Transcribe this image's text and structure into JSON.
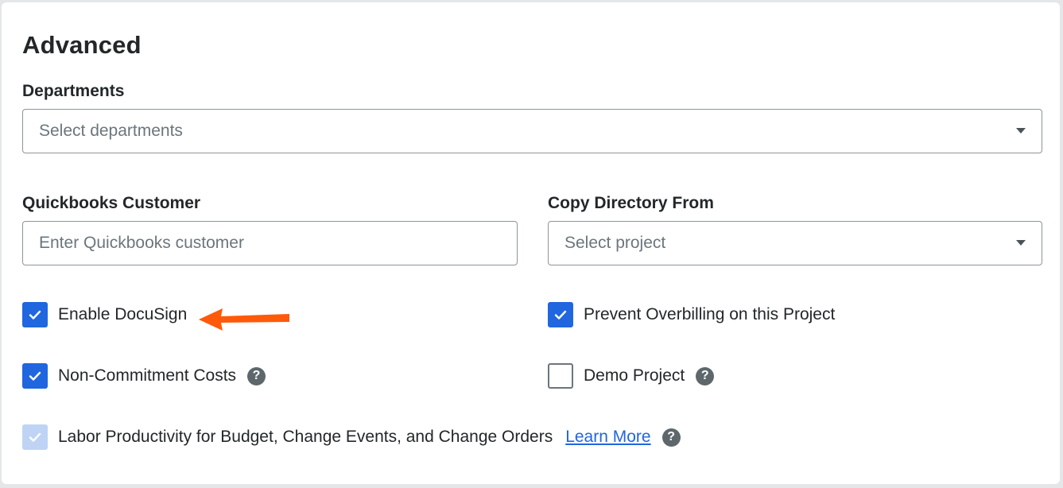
{
  "section": {
    "title": "Advanced"
  },
  "departments": {
    "label": "Departments",
    "placeholder": "Select departments"
  },
  "quickbooks": {
    "label": "Quickbooks Customer",
    "placeholder": "Enter Quickbooks customer"
  },
  "copy_directory": {
    "label": "Copy Directory From",
    "placeholder": "Select project"
  },
  "checkboxes": {
    "enable_docusign": {
      "label": "Enable DocuSign",
      "checked": true
    },
    "prevent_overbilling": {
      "label": "Prevent Overbilling on this Project",
      "checked": true
    },
    "non_commitment_costs": {
      "label": "Non-Commitment Costs",
      "checked": true
    },
    "demo_project": {
      "label": "Demo Project",
      "checked": false
    },
    "labor_productivity": {
      "label": "Labor Productivity for Budget, Change Events, and Change Orders",
      "checked": true,
      "disabled": true,
      "link": "Learn More"
    }
  },
  "icons": {
    "help": "?",
    "check": "check-icon",
    "caret": "chevron-down-icon",
    "annotation": "arrow-left-icon"
  },
  "colors": {
    "accent": "#2066df",
    "accent_disabled": "#bfd3f5",
    "annotation_arrow": "#ff5a0a",
    "help_icon": "#5d676c"
  }
}
